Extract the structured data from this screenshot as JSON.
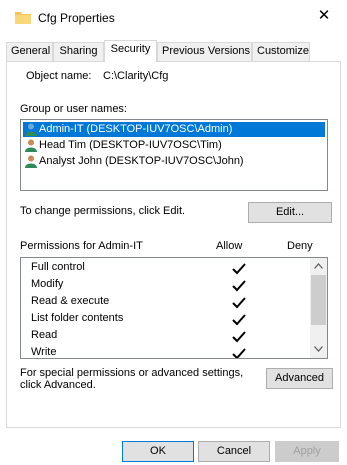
{
  "window": {
    "title": "Cfg Properties",
    "close_glyph": "✕"
  },
  "tabs": [
    {
      "label": "General"
    },
    {
      "label": "Sharing"
    },
    {
      "label": "Security"
    },
    {
      "label": "Previous Versions"
    },
    {
      "label": "Customize"
    }
  ],
  "active_tab": "Security",
  "object": {
    "label": "Object name:",
    "value": "C:\\Clarity\\Cfg"
  },
  "groups": {
    "label": "Group or user names:",
    "users": [
      {
        "name": "Admin-IT (DESKTOP-IUV7OSC\\Admin)",
        "selected": true
      },
      {
        "name": "Head Tim (DESKTOP-IUV7OSC\\Tim)",
        "selected": false
      },
      {
        "name": "Analyst John (DESKTOP-IUV7OSC\\John)",
        "selected": false
      }
    ]
  },
  "change_note": "To change permissions, click Edit.",
  "edit_button": "Edit...",
  "permissions": {
    "label": "Permissions for Admin-IT",
    "allow_header": "Allow",
    "deny_header": "Deny",
    "items": [
      {
        "name": "Full control",
        "allow": true,
        "deny": false
      },
      {
        "name": "Modify",
        "allow": true,
        "deny": false
      },
      {
        "name": "Read & execute",
        "allow": true,
        "deny": false
      },
      {
        "name": "List folder contents",
        "allow": true,
        "deny": false
      },
      {
        "name": "Read",
        "allow": true,
        "deny": false
      },
      {
        "name": "Write",
        "allow": true,
        "deny": false
      }
    ]
  },
  "advanced": {
    "note_line1": "For special permissions or advanced settings,",
    "note_line2": "click Advanced.",
    "button": "Advanced"
  },
  "footer": {
    "ok": "OK",
    "cancel": "Cancel",
    "apply": "Apply"
  },
  "colors": {
    "selection": "#0078d7",
    "folder": "#f2c55c",
    "user_head": "#2e8b57"
  }
}
